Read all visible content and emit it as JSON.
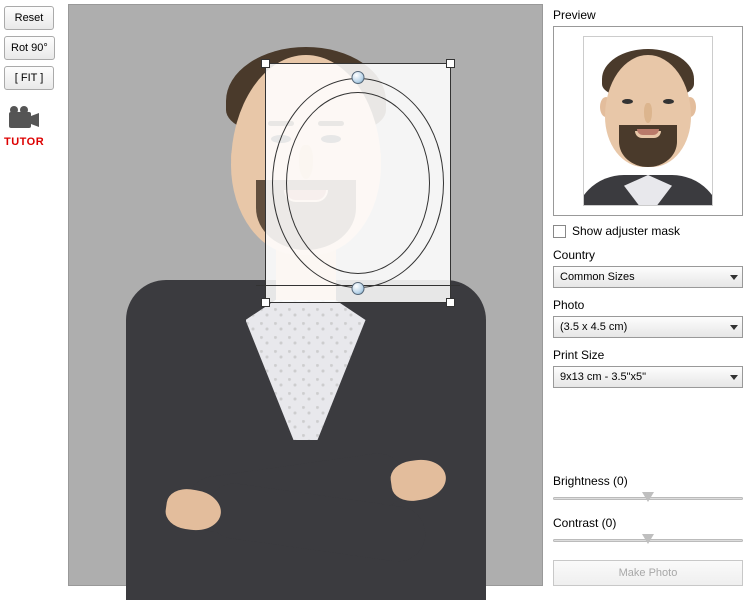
{
  "left": {
    "reset": "Reset",
    "rotate": "Rot 90°",
    "fit": "[ FIT ]",
    "tutor": "TUTOR"
  },
  "right": {
    "preview_label": "Preview",
    "show_mask": "Show adjuster mask",
    "show_mask_checked": false,
    "country_label": "Country",
    "country_value": "Common Sizes",
    "photo_label": "Photo",
    "photo_value": "(3.5 x 4.5 cm)",
    "print_label": "Print Size",
    "print_value": "9x13 cm - 3.5\"x5\"",
    "brightness_label": "Brightness (0)",
    "brightness_value": 0,
    "contrast_label": "Contrast (0)",
    "contrast_value": 0,
    "make_photo": "Make Photo",
    "make_photo_enabled": false
  }
}
